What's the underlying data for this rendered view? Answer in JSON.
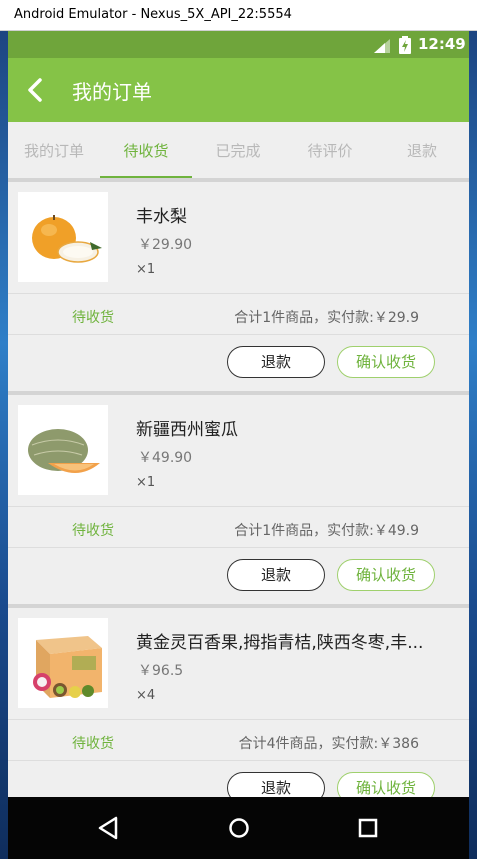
{
  "window": {
    "title": "Android Emulator - Nexus_5X_API_22:5554"
  },
  "statusbar": {
    "time": "12:49",
    "icons": [
      "signal-icon",
      "battery-icon"
    ]
  },
  "appbar": {
    "title": "我的订单",
    "back_icon": "back-arrow-icon"
  },
  "tabs": [
    {
      "label": "我的订单"
    },
    {
      "label": "待收货"
    },
    {
      "label": "已完成"
    },
    {
      "label": "待评价"
    },
    {
      "label": "退款"
    }
  ],
  "active_tab": "待收货",
  "orders": [
    {
      "name": "丰水梨",
      "price": "￥29.90",
      "qty": "×1",
      "status": "待收货",
      "total": "合计1件商品，实付款:￥29.9",
      "refund_label": "退款",
      "confirm_label": "确认收货",
      "image": "pear-icon"
    },
    {
      "name": "新疆西州蜜瓜",
      "price": "￥49.90",
      "qty": "×1",
      "status": "待收货",
      "total": "合计1件商品，实付款:￥49.9",
      "refund_label": "退款",
      "confirm_label": "确认收货",
      "image": "melon-icon"
    },
    {
      "name": "黄金灵百香果,拇指青桔,陕西冬枣,丰...",
      "price": "￥96.5",
      "qty": "×4",
      "status": "待收货",
      "total": "合计4件商品，实付款:￥386",
      "refund_label": "退款",
      "confirm_label": "确认收货",
      "image": "fruit-box-icon"
    }
  ],
  "navbar": {
    "icons": [
      "nav-back-icon",
      "nav-home-icon",
      "nav-recents-icon"
    ]
  },
  "colors": {
    "accent": "#85c347",
    "statusbar": "#6fa53b",
    "active_tab": "#6fb33d"
  }
}
